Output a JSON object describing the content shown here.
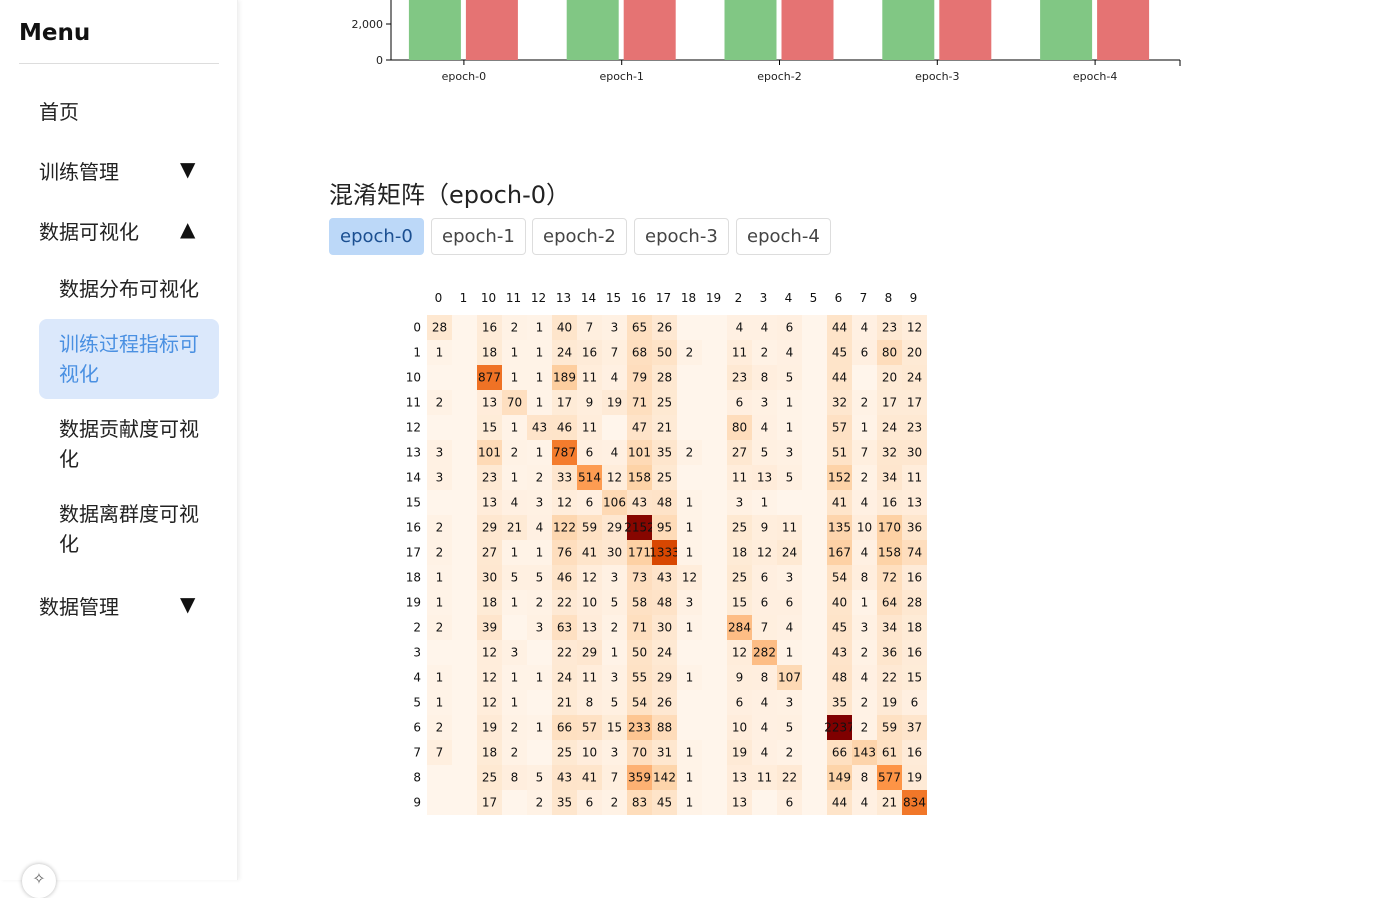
{
  "menu": {
    "title": "Menu",
    "items": [
      {
        "label": "首页",
        "arrow": ""
      },
      {
        "label": "训练管理",
        "arrow": "▼"
      },
      {
        "label": "数据可视化",
        "arrow": "▲"
      },
      {
        "label": "数据管理",
        "arrow": "▼"
      }
    ],
    "sub_items": [
      {
        "label": "数据分布可视化"
      },
      {
        "label": "训练过程指标可视化"
      },
      {
        "label": "数据贡献度可视化"
      },
      {
        "label": "数据离群度可视化"
      }
    ]
  },
  "bar_chart": {
    "type": "bar",
    "categories": [
      "epoch-0",
      "epoch-1",
      "epoch-2",
      "epoch-3",
      "epoch-4"
    ],
    "y_tick_labels": [
      "0",
      "2,000"
    ],
    "colors": [
      "#81c784",
      "#e57373"
    ]
  },
  "confusion": {
    "title": "混淆矩阵（epoch-0）",
    "tabs": [
      "epoch-0",
      "epoch-1",
      "epoch-2",
      "epoch-3",
      "epoch-4"
    ],
    "active_tab": 0
  },
  "chart_data": {
    "type": "heatmap",
    "labels": [
      "0",
      "1",
      "10",
      "11",
      "12",
      "13",
      "14",
      "15",
      "16",
      "17",
      "18",
      "19",
      "2",
      "3",
      "4",
      "5",
      "6",
      "7",
      "8",
      "9"
    ],
    "matrix": [
      [
        28,
        null,
        16,
        2,
        1,
        40,
        7,
        3,
        65,
        26,
        null,
        null,
        4,
        4,
        6,
        null,
        44,
        4,
        23,
        12
      ],
      [
        1,
        null,
        18,
        1,
        1,
        24,
        16,
        7,
        68,
        50,
        2,
        null,
        11,
        2,
        4,
        null,
        45,
        6,
        80,
        20
      ],
      [
        null,
        null,
        877,
        1,
        1,
        189,
        11,
        4,
        79,
        28,
        null,
        null,
        23,
        8,
        5,
        null,
        44,
        null,
        20,
        24
      ],
      [
        2,
        null,
        13,
        70,
        1,
        17,
        9,
        19,
        71,
        25,
        null,
        null,
        6,
        3,
        1,
        null,
        32,
        2,
        17,
        17
      ],
      [
        null,
        null,
        15,
        1,
        43,
        46,
        11,
        null,
        47,
        21,
        null,
        null,
        80,
        4,
        1,
        null,
        57,
        1,
        24,
        23
      ],
      [
        3,
        null,
        101,
        2,
        1,
        787,
        6,
        4,
        101,
        35,
        2,
        null,
        27,
        5,
        3,
        null,
        51,
        7,
        32,
        30
      ],
      [
        3,
        null,
        23,
        1,
        2,
        33,
        514,
        12,
        158,
        25,
        null,
        null,
        11,
        13,
        5,
        null,
        152,
        2,
        34,
        11
      ],
      [
        null,
        null,
        13,
        4,
        3,
        12,
        6,
        106,
        43,
        48,
        1,
        null,
        3,
        1,
        null,
        null,
        41,
        4,
        16,
        13
      ],
      [
        2,
        null,
        29,
        21,
        4,
        122,
        59,
        29,
        2152,
        95,
        1,
        null,
        25,
        9,
        11,
        null,
        135,
        10,
        170,
        36
      ],
      [
        2,
        null,
        27,
        1,
        1,
        76,
        41,
        30,
        171,
        1333,
        1,
        null,
        18,
        12,
        24,
        null,
        167,
        4,
        158,
        74
      ],
      [
        1,
        null,
        30,
        5,
        5,
        46,
        12,
        3,
        73,
        43,
        12,
        null,
        25,
        6,
        3,
        null,
        54,
        8,
        72,
        16
      ],
      [
        1,
        null,
        18,
        1,
        2,
        22,
        10,
        5,
        58,
        48,
        3,
        null,
        15,
        6,
        6,
        null,
        40,
        1,
        64,
        28
      ],
      [
        2,
        null,
        39,
        null,
        3,
        63,
        13,
        2,
        71,
        30,
        1,
        null,
        284,
        7,
        4,
        null,
        45,
        3,
        34,
        18
      ],
      [
        null,
        null,
        12,
        3,
        null,
        22,
        29,
        1,
        50,
        24,
        null,
        null,
        12,
        282,
        1,
        null,
        43,
        2,
        36,
        16
      ],
      [
        1,
        null,
        12,
        1,
        1,
        24,
        11,
        3,
        55,
        29,
        1,
        null,
        9,
        8,
        107,
        null,
        48,
        4,
        22,
        15
      ],
      [
        1,
        null,
        12,
        1,
        null,
        21,
        8,
        5,
        54,
        26,
        null,
        null,
        6,
        4,
        3,
        null,
        35,
        2,
        19,
        6
      ],
      [
        2,
        null,
        19,
        2,
        1,
        66,
        57,
        15,
        233,
        88,
        null,
        null,
        10,
        4,
        5,
        null,
        2237,
        2,
        59,
        37
      ],
      [
        7,
        null,
        18,
        2,
        null,
        25,
        10,
        3,
        70,
        31,
        1,
        null,
        19,
        4,
        2,
        null,
        66,
        143,
        61,
        16
      ],
      [
        null,
        null,
        25,
        8,
        5,
        43,
        41,
        7,
        359,
        142,
        1,
        null,
        13,
        11,
        22,
        null,
        149,
        8,
        577,
        19
      ],
      [
        null,
        null,
        17,
        null,
        2,
        35,
        6,
        2,
        83,
        45,
        1,
        null,
        13,
        null,
        6,
        null,
        44,
        4,
        21,
        834
      ]
    ],
    "max": 2237
  },
  "fab_icon": "pin-icon"
}
